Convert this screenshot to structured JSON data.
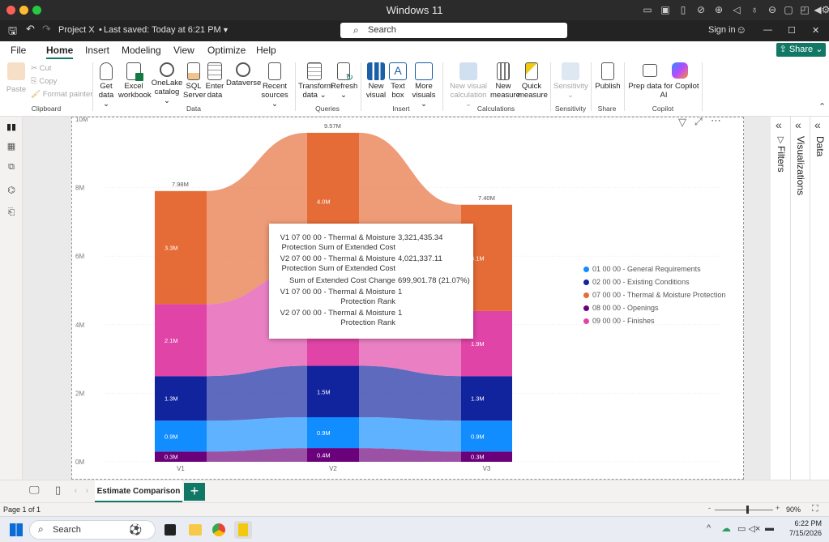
{
  "os": {
    "window_title": "Windows 11"
  },
  "titlebar": {
    "project": "Project X",
    "saved": "Last saved: Today at 6:21 PM",
    "search_placeholder": "Search",
    "sign_in": "Sign in"
  },
  "menu": {
    "items": [
      "File",
      "Home",
      "Insert",
      "Modeling",
      "View",
      "Optimize",
      "Help"
    ],
    "active": "Home",
    "share": "Share"
  },
  "ribbon": {
    "clipboard": {
      "paste": "Paste",
      "cut": "Cut",
      "copy": "Copy",
      "format_painter": "Format painter",
      "group": "Clipboard"
    },
    "data": {
      "get_data": [
        "Get",
        "data"
      ],
      "excel": [
        "Excel",
        "workbook"
      ],
      "onelake": [
        "OneLake",
        "catalog"
      ],
      "sql": [
        "SQL",
        "Server"
      ],
      "enter": [
        "Enter",
        "data"
      ],
      "dataverse": "Dataverse",
      "recent": [
        "Recent",
        "sources"
      ],
      "group": "Data"
    },
    "queries": {
      "transform": [
        "Transform",
        "data"
      ],
      "refresh": "Refresh",
      "group": "Queries"
    },
    "insert": {
      "new_visual": [
        "New",
        "visual"
      ],
      "text_box": [
        "Text",
        "box"
      ],
      "more_visuals": [
        "More",
        "visuals"
      ],
      "group": "Insert"
    },
    "calculations": {
      "new_visual_calc": [
        "New visual",
        "calculation"
      ],
      "new_measure": [
        "New",
        "measure"
      ],
      "quick_measure": [
        "Quick",
        "measure"
      ],
      "group": "Calculations"
    },
    "sensitivity": {
      "label": "Sensitivity",
      "group": "Sensitivity"
    },
    "share": {
      "publish": "Publish",
      "group": "Share"
    },
    "copilot": {
      "prep": [
        "Prep data for Copilot",
        "AI"
      ],
      "group": "Copilot"
    }
  },
  "panes": {
    "filters": "Filters",
    "visualizations": "Visualizations",
    "data": "Data"
  },
  "chart_data": {
    "type": "area",
    "subtype": "ribbon",
    "categories": [
      "V1",
      "V2",
      "V3"
    ],
    "ylim": [
      0,
      10000000
    ],
    "y_ticks": [
      "0M",
      "2M",
      "4M",
      "6M",
      "8M",
      "10M"
    ],
    "totals": [
      "7.98M",
      "9.57M",
      "7.40M"
    ],
    "series": [
      {
        "name": "01 00 00 - General Requirements",
        "color": "#118dff",
        "values": [
          0.9,
          0.9,
          0.9
        ],
        "labels": [
          "0.9M",
          "0.9M",
          "0.9M"
        ]
      },
      {
        "name": "02 00 00 - Existing Conditions",
        "color": "#12239e",
        "values": [
          1.3,
          1.5,
          1.3
        ],
        "labels": [
          "1.3M",
          "1.5M",
          "1.3M"
        ]
      },
      {
        "name": "07 00 00 - Thermal & Moisture Protection",
        "color": "#e66c37",
        "values": [
          3.3,
          4.0,
          3.1
        ],
        "labels": [
          "3.3M",
          "4.0M",
          "3.1M"
        ]
      },
      {
        "name": "08 00 00 - Openings",
        "color": "#6b007b",
        "values": [
          0.3,
          0.4,
          0.3
        ],
        "labels": [
          "0.3M",
          "0.4M",
          "0.3M"
        ]
      },
      {
        "name": "09 00 00 - Finishes",
        "color": "#e044a7",
        "values": [
          2.1,
          2.8,
          1.9
        ],
        "labels": [
          "2.1M",
          "",
          "1.9M"
        ]
      }
    ],
    "stack_order": [
      "08 00 00 - Openings",
      "01 00 00 - General Requirements",
      "02 00 00 - Existing Conditions",
      "09 00 00 - Finishes",
      "07 00 00 - Thermal & Moisture Protection"
    ]
  },
  "tooltip": {
    "rows": [
      {
        "label": [
          "V1 07 00 00 - Thermal & Moisture",
          "Protection Sum of Extended Cost"
        ],
        "value": "3,321,435.34"
      },
      {
        "label": [
          "V2 07 00 00 - Thermal & Moisture",
          "Protection Sum of Extended Cost"
        ],
        "value": "4,021,337.11"
      },
      {
        "label": [
          "Sum of Extended Cost Change"
        ],
        "value": "699,901.78 (21.07%)"
      },
      {
        "label": [
          "V1 07 00 00 - Thermal & Moisture",
          "Protection Rank"
        ],
        "value": "1"
      },
      {
        "label": [
          "V2 07 00 00 - Thermal & Moisture",
          "Protection Rank"
        ],
        "value": "1"
      }
    ]
  },
  "tabs": {
    "page": "Estimate Comparison"
  },
  "status": {
    "page": "Page 1 of 1",
    "zoom": "90%",
    "zoom_level": 0.55
  },
  "taskbar": {
    "search": "Search",
    "time": "6:22 PM",
    "date": "7/15/2026"
  }
}
